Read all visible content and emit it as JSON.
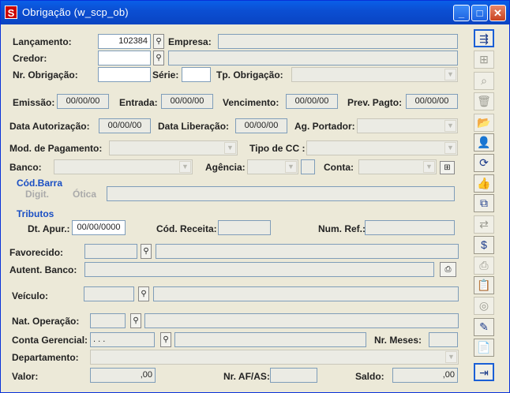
{
  "window": {
    "title": "Obrigação (w_scp_ob)",
    "app_icon": "S",
    "minimize": "_",
    "maximize": "□",
    "close": "✕"
  },
  "labels": {
    "lancamento": "Lançamento:",
    "empresa": "Empresa:",
    "credor": "Credor:",
    "nr_obrigacao": "Nr. Obrigação:",
    "serie": "Série:",
    "tp_obrigacao": "Tp. Obrigação:",
    "emissao": "Emissão:",
    "entrada": "Entrada:",
    "vencimento": "Vencimento:",
    "prev_pagto": "Prev. Pagto:",
    "data_autorizacao": "Data Autorização:",
    "data_liberacao": "Data Liberação:",
    "ag_portador": "Ag. Portador:",
    "mod_pagamento": "Mod. de Pagamento:",
    "tipo_cc": "Tipo de CC :",
    "banco": "Banco:",
    "agencia": "Agência:",
    "conta": "Conta:",
    "cod_barra": "Cód.Barra",
    "digit": "Digit.",
    "otica": "Ótica",
    "tributos": "Tributos",
    "dt_apur": "Dt. Apur.:",
    "cod_receita": "Cód. Receita:",
    "num_ref": "Num. Ref.:",
    "favorecido": "Favorecido:",
    "autent_banco": "Autent. Banco:",
    "veiculo": "Veículo:",
    "nat_operacao": "Nat. Operação:",
    "conta_gerencial": "Conta Gerencial:",
    "nr_meses": "Nr. Meses:",
    "departamento": "Departamento:",
    "valor": "Valor:",
    "nr_af_as": "Nr. AF/AS:",
    "saldo": "Saldo:"
  },
  "values": {
    "lancamento": "102384",
    "emissao": "00/00/00",
    "entrada": "00/00/00",
    "vencimento": "00/00/00",
    "prev_pagto": "00/00/00",
    "data_autorizacao": "00/00/00",
    "data_liberacao": "00/00/00",
    "dt_apur": "00/00/0000",
    "conta_gerencial": ". . .",
    "valor": ",00",
    "saldo": ",00"
  },
  "icons": {
    "lookup": "search-icon",
    "toolbar": [
      "insert-row-icon",
      "add-row-icon",
      "preview-icon",
      "delete-icon",
      "open-icon",
      "user-icon",
      "refresh-icon",
      "approve-icon",
      "copy-icon",
      "transfer-icon",
      "money-icon",
      "print-icon",
      "report-icon",
      "stack-icon",
      "edit-icon",
      "document-icon",
      "exit-icon"
    ]
  },
  "glyphs": {
    "lookup": "⚲",
    "arrow": "▼",
    "side": [
      "⇶",
      "⊞",
      "⌕",
      "🗑",
      "📂",
      "👤",
      "⟳",
      "👍",
      "⧉",
      "⇄",
      "$",
      "⎙",
      "📋",
      "◎",
      "✎",
      "📄",
      "⇥"
    ]
  }
}
